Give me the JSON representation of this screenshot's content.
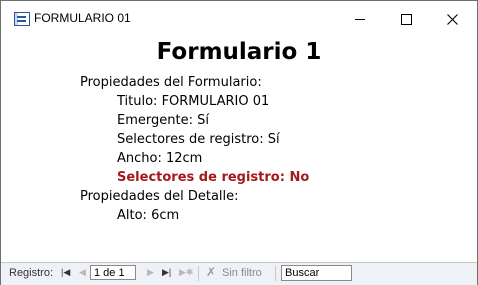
{
  "window": {
    "title": "FORMULARIO 01"
  },
  "form": {
    "heading": "Formulario 1",
    "lines": [
      {
        "text": "Propiedades del Formulario:",
        "level": 0
      },
      {
        "text": "Titulo: FORMULARIO 01",
        "level": 1
      },
      {
        "text": "Emergente: Sí",
        "level": 1
      },
      {
        "text": "Selectores de registro: Sí",
        "level": 1
      },
      {
        "text": "Ancho: 12cm",
        "level": 1
      },
      {
        "text": "Selectores de registro: No",
        "level": 1,
        "highlight": true
      },
      {
        "text": "Propiedades del Detalle:",
        "level": 0
      },
      {
        "text": "Alto: 6cm",
        "level": 1
      }
    ],
    "highlight_color": "#a5191c"
  },
  "navigation": {
    "label": "Registro:",
    "current_record": "1 de 1",
    "filter_label": "Sin filtro",
    "search_placeholder": "Buscar"
  },
  "icons": {
    "app": "form-icon",
    "first": "first-record-icon",
    "prev": "previous-record-icon",
    "next": "next-record-icon",
    "last": "last-record-icon",
    "new": "new-record-icon",
    "filter": "filter-icon"
  }
}
